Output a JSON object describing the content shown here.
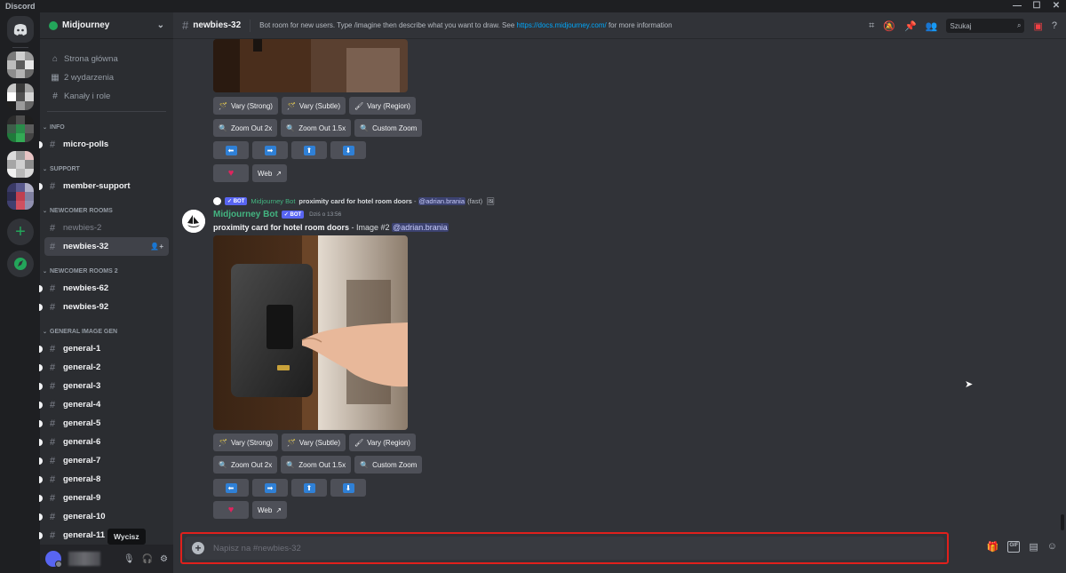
{
  "app": {
    "title": "Discord"
  },
  "window": {
    "minimize": "—",
    "maximize": "☐",
    "close": "✕"
  },
  "guild": {
    "name": "Midjourney"
  },
  "nav": [
    {
      "label": "Strona główna",
      "icon": "home-icon"
    },
    {
      "label": "2 wydarzenia",
      "icon": "calendar-icon"
    },
    {
      "label": "Kanały i role",
      "icon": "channels-roles-icon"
    }
  ],
  "categories": [
    {
      "name": "INFO",
      "channels": [
        {
          "name": "micro-polls",
          "state": "unread"
        }
      ]
    },
    {
      "name": "SUPPORT",
      "channels": [
        {
          "name": "member-support",
          "state": "unread"
        }
      ]
    },
    {
      "name": "NEWCOMER ROOMS",
      "channels": [
        {
          "name": "newbies-2",
          "state": "muted"
        },
        {
          "name": "newbies-32",
          "state": "active"
        }
      ]
    },
    {
      "name": "NEWCOMER ROOMS 2",
      "channels": [
        {
          "name": "newbies-62",
          "state": "unread"
        },
        {
          "name": "newbies-92",
          "state": "unread"
        }
      ]
    },
    {
      "name": "GENERAL IMAGE GEN",
      "channels": [
        {
          "name": "general-1",
          "state": "unread"
        },
        {
          "name": "general-2",
          "state": "unread"
        },
        {
          "name": "general-3",
          "state": "unread"
        },
        {
          "name": "general-4",
          "state": "unread"
        },
        {
          "name": "general-5",
          "state": "unread"
        },
        {
          "name": "general-6",
          "state": "unread"
        },
        {
          "name": "general-7",
          "state": "unread"
        },
        {
          "name": "general-8",
          "state": "unread"
        },
        {
          "name": "general-9",
          "state": "unread"
        },
        {
          "name": "general-10",
          "state": "unread"
        },
        {
          "name": "general-11",
          "state": "unread"
        }
      ]
    }
  ],
  "user_panel": {
    "tooltip": "Wycisz"
  },
  "header": {
    "channel": "newbies-32",
    "topic_prefix": "Bot room for new users. Type /imagine then describe what you want to draw. See ",
    "topic_link": "https://docs.midjourney.com/",
    "topic_suffix": " for more information",
    "search_placeholder": "Szukaj"
  },
  "buttons": {
    "vary_strong": "Vary (Strong)",
    "vary_subtle": "Vary (Subtle)",
    "vary_region": "Vary (Region)",
    "zoom_out_2x": "Zoom Out 2x",
    "zoom_out_15x": "Zoom Out 1.5x",
    "custom_zoom": "Custom Zoom",
    "web": "Web"
  },
  "message": {
    "reply_author": "Midjourney Bot",
    "reply_prompt": "proximity card for hotel room doors",
    "reply_sep": " - ",
    "reply_mention": "@adrian.brania",
    "reply_speed": "(fast)",
    "bot_tag": "BOT",
    "author": "Midjourney Bot",
    "timestamp": "Dziś o 13:56",
    "prompt": "proximity card for hotel room doors",
    "image_label": " - Image #2 ",
    "mention": "@adrian.brania"
  },
  "composer": {
    "placeholder": "Napisz na #newbies-32"
  }
}
